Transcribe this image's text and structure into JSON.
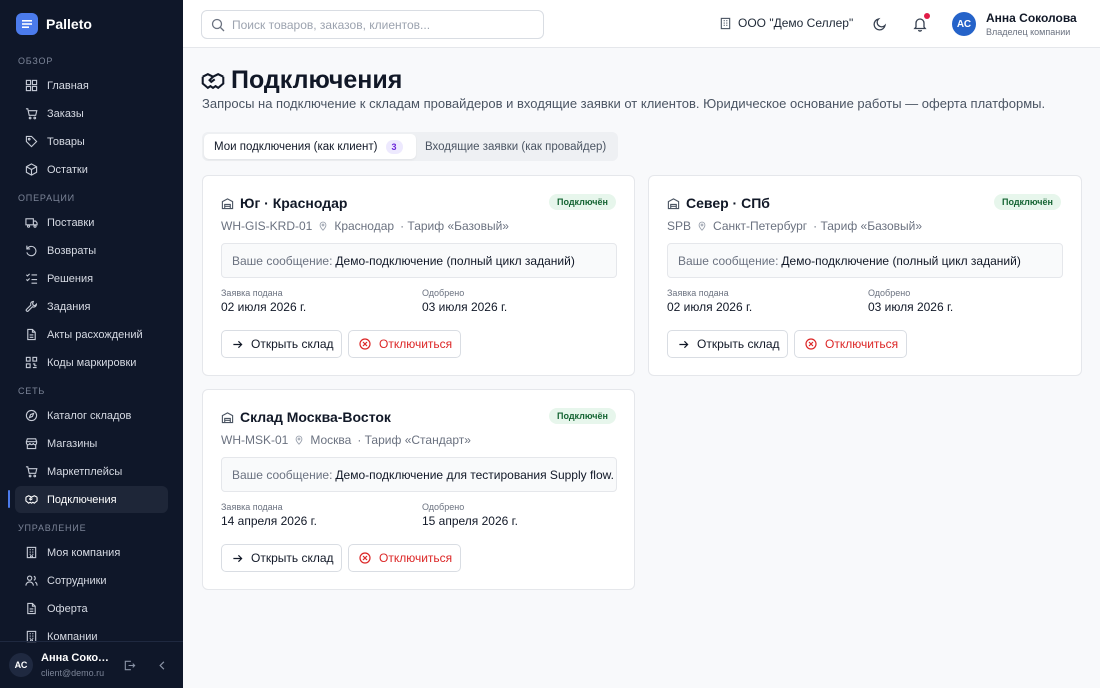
{
  "app": {
    "name": "Palleto"
  },
  "sidebar": {
    "sections": [
      {
        "title": "Обзор",
        "items": [
          {
            "label": "Главная",
            "icon": "home-icon"
          },
          {
            "label": "Заказы",
            "icon": "cart-icon"
          },
          {
            "label": "Товары",
            "icon": "tag-icon"
          },
          {
            "label": "Остатки",
            "icon": "box-icon"
          }
        ]
      },
      {
        "title": "Операции",
        "items": [
          {
            "label": "Поставки",
            "icon": "truck-icon"
          },
          {
            "label": "Возвраты",
            "icon": "return-icon"
          },
          {
            "label": "Решения",
            "icon": "checklist-icon"
          },
          {
            "label": "Задания",
            "icon": "wrench-icon"
          },
          {
            "label": "Акты расхождений",
            "icon": "document-icon"
          },
          {
            "label": "Коды маркировки",
            "icon": "qr-icon"
          }
        ]
      },
      {
        "title": "Сеть",
        "items": [
          {
            "label": "Каталог складов",
            "icon": "compass-icon"
          },
          {
            "label": "Магазины",
            "icon": "store-icon"
          },
          {
            "label": "Маркетплейсы",
            "icon": "cart-icon"
          },
          {
            "label": "Подключения",
            "icon": "handshake-icon"
          }
        ]
      },
      {
        "title": "Управление",
        "items": [
          {
            "label": "Моя компания",
            "icon": "building-icon"
          },
          {
            "label": "Сотрудники",
            "icon": "users-icon"
          },
          {
            "label": "Оферта",
            "icon": "document-icon"
          },
          {
            "label": "Компании",
            "icon": "building-icon"
          }
        ]
      }
    ],
    "active_item": "Подключения",
    "user": {
      "initials": "АС",
      "name": "Анна Соколова",
      "email": "client@demo.ru"
    }
  },
  "topbar": {
    "search_placeholder": "Поиск товаров, заказов, клиентов...",
    "company": "ООО \"Демо Селлер\"",
    "user": {
      "initials": "АС",
      "name": "Анна Соколова",
      "role": "Владелец компании"
    },
    "has_notifications": true
  },
  "page": {
    "title": "Подключения",
    "subtitle": "Запросы на подключение к складам провайдеров и входящие заявки от клиентов. Юридическое основание работы — оферта платформы.",
    "tabs": [
      {
        "label": "Мои подключения (как клиент)",
        "count": "3",
        "active": true
      },
      {
        "label": "Входящие заявки (как провайдер)",
        "active": false
      }
    ]
  },
  "connections": [
    {
      "title": "Юг · Краснодар",
      "status": "Подключён",
      "code": "WH-GIS-KRD-01",
      "city": "Краснодар",
      "tariff": "· Тариф «Базовый»",
      "message_label": "Ваше сообщение:",
      "message": "Демо-подключение (полный цикл заданий)",
      "submitted_label": "Заявка подана",
      "submitted": "02 июля 2026 г.",
      "approved_label": "Одобрено",
      "approved": "03 июля 2026 г.",
      "open_label": "Открыть склад",
      "disconnect_label": "Отключиться"
    },
    {
      "title": "Север · СПб",
      "status": "Подключён",
      "code": "SPB",
      "city": "Санкт-Петербург",
      "tariff": "· Тариф «Базовый»",
      "message_label": "Ваше сообщение:",
      "message": "Демо-подключение (полный цикл заданий)",
      "submitted_label": "Заявка подана",
      "submitted": "02 июля 2026 г.",
      "approved_label": "Одобрено",
      "approved": "03 июля 2026 г.",
      "open_label": "Открыть склад",
      "disconnect_label": "Отключиться"
    },
    {
      "title": "Склад Москва-Восток",
      "status": "Подключён",
      "code": "WH-MSK-01",
      "city": "Москва",
      "tariff": "· Тариф «Стандарт»",
      "message_label": "Ваше сообщение:",
      "message": "Демо-подключение для тестирования Supply flow.",
      "submitted_label": "Заявка подана",
      "submitted": "14 апреля 2026 г.",
      "approved_label": "Одобрено",
      "approved": "15 апреля 2026 г.",
      "open_label": "Открыть склад",
      "disconnect_label": "Отключиться"
    }
  ],
  "colors": {
    "sidebar_bg": "#0f1729",
    "accent": "#4b7bec",
    "badge_bg": "#e7f6ec",
    "badge_text": "#166534",
    "danger": "#dc2626"
  }
}
